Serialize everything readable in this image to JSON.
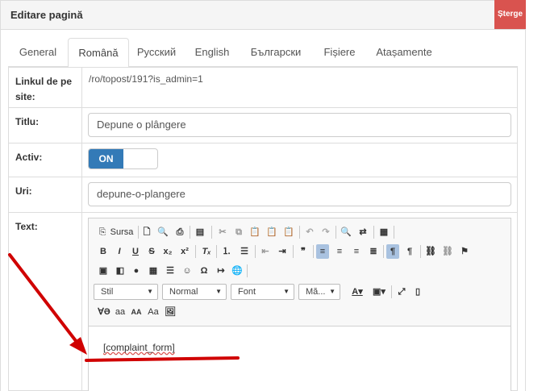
{
  "header": {
    "title": "Editare pagină",
    "delete_label": "Șterge",
    "delete_color": "#d9534f"
  },
  "tabs": [
    {
      "label": "General",
      "active": false
    },
    {
      "label": "Română",
      "active": true
    },
    {
      "label": "Русский",
      "active": false
    },
    {
      "label": "English",
      "active": false
    },
    {
      "label": "Български",
      "active": false
    },
    {
      "label": "Fișiere",
      "active": false
    },
    {
      "label": "Atașamente",
      "active": false
    }
  ],
  "form": {
    "link_label": "Linkul de pe site:",
    "link_value": "/ro/topost/191?is_admin=1",
    "title_label": "Titlu:",
    "title_value": "Depune o plângere",
    "active_label": "Activ:",
    "active_value": "ON",
    "active_color": "#337ab7",
    "uri_label": "Uri:",
    "uri_value": "depune-o-plangere",
    "text_label": "Text:"
  },
  "editor": {
    "source_label": "Sursa",
    "format_combos": [
      "Stil",
      "Normal",
      "Font",
      "Mă..."
    ],
    "style_buttons": [
      "aa",
      "AA",
      "Aa"
    ],
    "content": "[complaint_form]"
  },
  "annotation": {
    "color": "#d00000"
  }
}
